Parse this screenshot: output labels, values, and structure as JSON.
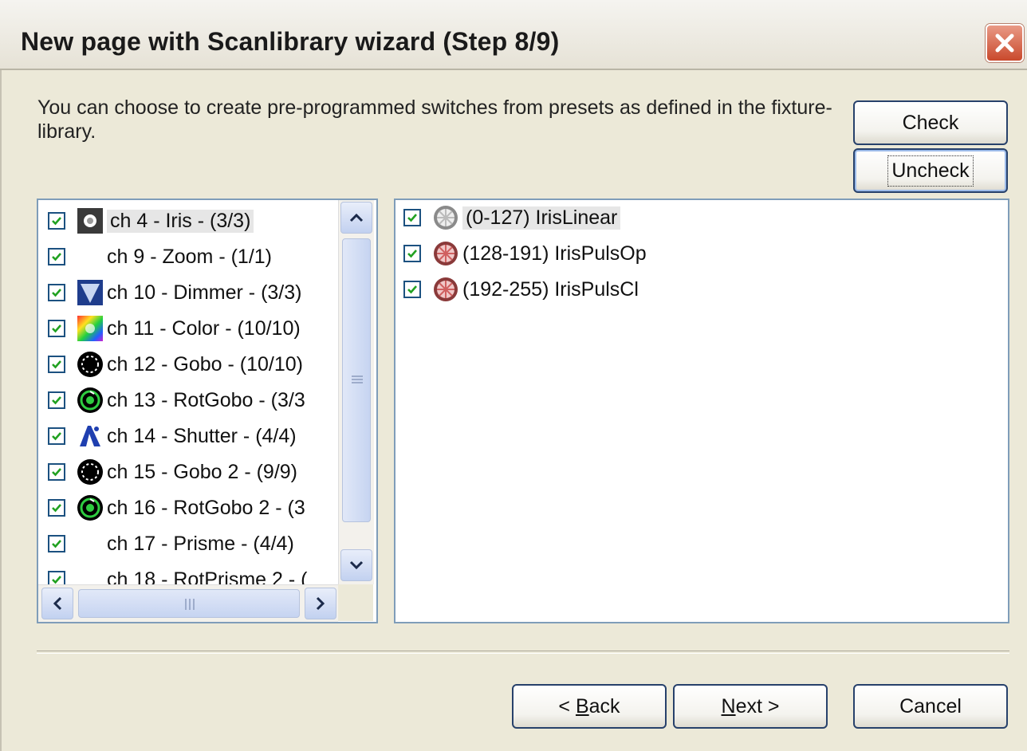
{
  "window": {
    "title": "New page with Scanlibrary wizard (Step 8/9)",
    "close_icon": "close-icon"
  },
  "instructions": "You can choose to create pre-programmed switches from presets as defined in the fixture-library.",
  "side_buttons": {
    "check": "Check",
    "uncheck": "Uncheck"
  },
  "channels": [
    {
      "label": "ch 4 - Iris - (3/3)",
      "icon": "iris-icon",
      "checked": true,
      "selected": true
    },
    {
      "label": "ch 9 - Zoom - (1/1)",
      "icon": "",
      "checked": true
    },
    {
      "label": "ch 10 - Dimmer - (3/3)",
      "icon": "dimmer-icon",
      "checked": true
    },
    {
      "label": "ch 11 - Color - (10/10)",
      "icon": "color-wheel-icon",
      "checked": true
    },
    {
      "label": "ch 12 - Gobo - (10/10)",
      "icon": "gobo-icon",
      "checked": true
    },
    {
      "label": "ch 13 - RotGobo - (3/3",
      "icon": "rotgobo-icon",
      "checked": true
    },
    {
      "label": "ch 14 - Shutter - (4/4)",
      "icon": "shutter-icon",
      "checked": true
    },
    {
      "label": "ch 15 - Gobo 2 - (9/9)",
      "icon": "gobo-icon",
      "checked": true
    },
    {
      "label": "ch 16 - RotGobo 2 - (3",
      "icon": "rotgobo-icon",
      "checked": true
    },
    {
      "label": "ch 17 - Prisme - (4/4)",
      "icon": "",
      "checked": true
    },
    {
      "label": "ch 18 - RotPrisme 2 - (",
      "icon": "",
      "checked": true
    }
  ],
  "presets": [
    {
      "label": "(0-127) IrisLinear",
      "icon": "iris-linear-icon",
      "checked": true,
      "selected": true
    },
    {
      "label": "(128-191) IrisPulsOp",
      "icon": "iris-pulse-icon",
      "checked": true
    },
    {
      "label": "(192-255) IrisPulsCl",
      "icon": "iris-pulse-icon",
      "checked": true
    }
  ],
  "footer": {
    "back": "< Back",
    "next": "Next >",
    "cancel": "Cancel"
  }
}
